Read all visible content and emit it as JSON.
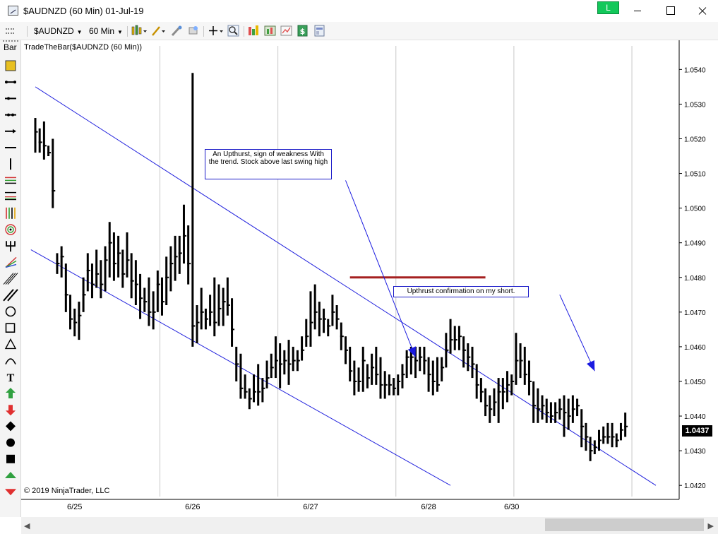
{
  "window": {
    "title": "$AUDNZD (60 Min)  01-Jul-19",
    "link_badge": "L",
    "link_badge_color": "#12c85a"
  },
  "toolbar": {
    "instrument": "$AUDNZD",
    "interval": "60 Min",
    "icons": [
      "bar-type-icon",
      "draw-line-icon",
      "pencil-icon",
      "zoom-icon",
      "crosshair-icon",
      "magnify-icon",
      "indicators-icon",
      "strategies-icon",
      "chart-properties-icon",
      "dollar-icon",
      "template-icon"
    ]
  },
  "left_tools": {
    "bar_label": "Bar",
    "tools": [
      "rectangle-tool-icon",
      "line-icon",
      "ray-icon",
      "extended-line-icon",
      "arrow-line-icon",
      "horizontal-line-icon",
      "vertical-line-icon",
      "fib-retracement-icon",
      "fib-extensions-icon",
      "fib-timezones-icon",
      "fib-circle-icon",
      "andrews-pitchfork-icon",
      "gann-fan-icon",
      "regression-channel-icon",
      "trend-channel-icon",
      "ellipse-icon",
      "rectangle-icon",
      "triangle-icon",
      "arc-icon",
      "text-icon",
      "arrow-up-icon",
      "arrow-down-icon",
      "diamond-icon",
      "dot-icon",
      "square-icon",
      "triangle-up-icon",
      "triangle-down-icon"
    ]
  },
  "chart": {
    "label": "TradeTheBar($AUDNZD (60 Min))",
    "copyright": "© 2019 NinjaTrader, LLC",
    "current_price": "1.0437",
    "annotation_1": "An Upthurst, sign of weakness With the trend. Stock above last swing high",
    "annotation_2": "Upthrust confirmation on my short."
  },
  "chart_data": {
    "type": "bar",
    "instrument": "$AUDNZD",
    "interval": "60 Min",
    "ylim": [
      1.0418,
      1.0547
    ],
    "price_ticks": [
      "1.0540",
      "1.0530",
      "1.0520",
      "1.0510",
      "1.0500",
      "1.0490",
      "1.0480",
      "1.0470",
      "1.0460",
      "1.0450",
      "1.0440",
      "1.0430",
      "1.0420"
    ],
    "date_ticks": [
      {
        "label": "6/25",
        "bar": 9
      },
      {
        "label": "6/26",
        "bar": 36
      },
      {
        "label": "6/27",
        "bar": 63
      },
      {
        "label": "6/28",
        "bar": 90
      },
      {
        "label": "6/30",
        "bar": 109
      }
    ],
    "session_breaks": [
      29,
      56,
      83,
      110,
      137
    ],
    "last_price": 1.0437,
    "hlc_bars": [
      [
        1.0526,
        1.0516,
        1.0522
      ],
      [
        1.0523,
        1.0516,
        1.0519
      ],
      [
        1.0525,
        1.0514,
        1.0518
      ],
      [
        1.0518,
        1.0515,
        1.0516
      ],
      [
        1.052,
        1.05,
        1.0505
      ],
      [
        1.0487,
        1.0481,
        1.0484
      ],
      [
        1.0489,
        1.048,
        1.0486
      ],
      [
        1.0484,
        1.047,
        1.0475
      ],
      [
        1.0475,
        1.0465,
        1.0468
      ],
      [
        1.0471,
        1.0463,
        1.0467
      ],
      [
        1.0473,
        1.0462,
        1.0469
      ],
      [
        1.048,
        1.047,
        1.0475
      ],
      [
        1.0487,
        1.0476,
        1.0482
      ],
      [
        1.0484,
        1.0474,
        1.0478
      ],
      [
        1.0488,
        1.0477,
        1.0481
      ],
      [
        1.0485,
        1.0474,
        1.0478
      ],
      [
        1.0489,
        1.0476,
        1.0485
      ],
      [
        1.0496,
        1.048,
        1.049
      ],
      [
        1.0493,
        1.0479,
        1.0484
      ],
      [
        1.0492,
        1.048,
        1.0487
      ],
      [
        1.0488,
        1.0477,
        1.0481
      ],
      [
        1.0493,
        1.048,
        1.0485
      ],
      [
        1.0487,
        1.0474,
        1.0479
      ],
      [
        1.0485,
        1.0472,
        1.0478
      ],
      [
        1.0481,
        1.0468,
        1.0474
      ],
      [
        1.0477,
        1.047,
        1.0473
      ],
      [
        1.048,
        1.0466,
        1.047
      ],
      [
        1.0476,
        1.0465,
        1.047
      ],
      [
        1.0482,
        1.047,
        1.0478
      ],
      [
        1.048,
        1.0469,
        1.0473
      ],
      [
        1.0486,
        1.0472,
        1.048
      ],
      [
        1.0489,
        1.0476,
        1.0484
      ],
      [
        1.0492,
        1.0479,
        1.0486
      ],
      [
        1.0492,
        1.0481,
        1.0487
      ],
      [
        1.0501,
        1.0484,
        1.0492
      ],
      [
        1.0495,
        1.0478,
        1.0484
      ],
      [
        1.0539,
        1.046,
        1.0466
      ],
      [
        1.0472,
        1.0461,
        1.0467
      ],
      [
        1.0477,
        1.0465,
        1.047
      ],
      [
        1.0471,
        1.0465,
        1.0468
      ],
      [
        1.0475,
        1.0466,
        1.047
      ],
      [
        1.048,
        1.0463,
        1.0467
      ],
      [
        1.0478,
        1.0466,
        1.0471
      ],
      [
        1.0477,
        1.0466,
        1.0473
      ],
      [
        1.048,
        1.0469,
        1.0472
      ],
      [
        1.0474,
        1.046,
        1.0465
      ],
      [
        1.046,
        1.045,
        1.0455
      ],
      [
        1.0458,
        1.0445,
        1.0448
      ],
      [
        1.0452,
        1.0445,
        1.0447
      ],
      [
        1.0448,
        1.0442,
        1.0445
      ],
      [
        1.0452,
        1.0444,
        1.0447
      ],
      [
        1.0455,
        1.0443,
        1.0447
      ],
      [
        1.0451,
        1.0444,
        1.0448
      ],
      [
        1.0456,
        1.0448,
        1.0451
      ],
      [
        1.0458,
        1.0451,
        1.0454
      ],
      [
        1.0463,
        1.0451,
        1.0456
      ],
      [
        1.0461,
        1.0448,
        1.0455
      ],
      [
        1.0459,
        1.0452,
        1.0456
      ],
      [
        1.0462,
        1.0449,
        1.0455
      ],
      [
        1.046,
        1.0453,
        1.0456
      ],
      [
        1.0459,
        1.0453,
        1.0456
      ],
      [
        1.0463,
        1.0456,
        1.0459
      ],
      [
        1.0468,
        1.046,
        1.0463
      ],
      [
        1.0476,
        1.046,
        1.0467
      ],
      [
        1.0478,
        1.0465,
        1.047
      ],
      [
        1.0473,
        1.0463,
        1.0468
      ],
      [
        1.0471,
        1.0464,
        1.0468
      ],
      [
        1.0468,
        1.0463,
        1.0466
      ],
      [
        1.0475,
        1.0466,
        1.047
      ],
      [
        1.0472,
        1.0465,
        1.0468
      ],
      [
        1.0467,
        1.0459,
        1.0463
      ],
      [
        1.0463,
        1.0455,
        1.0459
      ],
      [
        1.046,
        1.045,
        1.0453
      ],
      [
        1.0456,
        1.0446,
        1.045
      ],
      [
        1.0454,
        1.0447,
        1.045
      ],
      [
        1.046,
        1.0447,
        1.0456
      ],
      [
        1.0455,
        1.0448,
        1.0451
      ],
      [
        1.0458,
        1.0449,
        1.0454
      ],
      [
        1.046,
        1.0449,
        1.0452
      ],
      [
        1.0457,
        1.0445,
        1.0449
      ],
      [
        1.0453,
        1.0445,
        1.0449
      ],
      [
        1.0452,
        1.0446,
        1.0449
      ],
      [
        1.0451,
        1.0446,
        1.0448
      ],
      [
        1.0452,
        1.0446,
        1.045
      ],
      [
        1.0455,
        1.0448,
        1.0452
      ],
      [
        1.0459,
        1.0451,
        1.0457
      ],
      [
        1.046,
        1.0452,
        1.0457
      ],
      [
        1.046,
        1.0451,
        1.0456
      ],
      [
        1.046,
        1.0453,
        1.0457
      ],
      [
        1.046,
        1.0452,
        1.0456
      ],
      [
        1.0457,
        1.0447,
        1.0452
      ],
      [
        1.0456,
        1.0446,
        1.045
      ],
      [
        1.0457,
        1.0447,
        1.0449
      ],
      [
        1.0457,
        1.045,
        1.0454
      ],
      [
        1.0464,
        1.0454,
        1.0459
      ],
      [
        1.0468,
        1.0458,
        1.0462
      ],
      [
        1.0466,
        1.0459,
        1.0462
      ],
      [
        1.0466,
        1.0459,
        1.0463
      ],
      [
        1.0463,
        1.0454,
        1.0459
      ],
      [
        1.0461,
        1.0453,
        1.0457
      ],
      [
        1.046,
        1.0451,
        1.0455
      ],
      [
        1.0455,
        1.0445,
        1.0449
      ],
      [
        1.0451,
        1.0444,
        1.0447
      ],
      [
        1.0448,
        1.044,
        1.0443
      ],
      [
        1.0446,
        1.0438,
        1.0442
      ],
      [
        1.0448,
        1.044,
        1.0444
      ],
      [
        1.0451,
        1.0438,
        1.0447
      ],
      [
        1.0451,
        1.0442,
        1.0447
      ],
      [
        1.0453,
        1.0444,
        1.0449
      ],
      [
        1.0452,
        1.0446,
        1.045
      ],
      [
        1.0464,
        1.0449,
        1.0456
      ],
      [
        1.0461,
        1.0451,
        1.0456
      ],
      [
        1.046,
        1.0449,
        1.0452
      ],
      [
        1.0456,
        1.0446,
        1.045
      ],
      [
        1.045,
        1.0438,
        1.0443
      ],
      [
        1.0448,
        1.0438,
        1.0442
      ],
      [
        1.0446,
        1.0439,
        1.0443
      ],
      [
        1.0445,
        1.0438,
        1.0441
      ],
      [
        1.0444,
        1.0438,
        1.044
      ],
      [
        1.0444,
        1.0438,
        1.0441
      ],
      [
        1.0445,
        1.0439,
        1.0442
      ],
      [
        1.0446,
        1.0434,
        1.0441
      ],
      [
        1.0445,
        1.0436,
        1.044
      ],
      [
        1.0446,
        1.0438,
        1.0442
      ],
      [
        1.0445,
        1.044,
        1.0443
      ],
      [
        1.0442,
        1.0431,
        1.0437
      ],
      [
        1.0438,
        1.043,
        1.0434
      ],
      [
        1.0434,
        1.0427,
        1.043
      ],
      [
        1.0433,
        1.0429,
        1.0431
      ],
      [
        1.0436,
        1.043,
        1.0433
      ],
      [
        1.0437,
        1.0432,
        1.0434
      ],
      [
        1.0438,
        1.0432,
        1.0434
      ],
      [
        1.0438,
        1.0431,
        1.0434
      ],
      [
        1.0435,
        1.0431,
        1.0433
      ],
      [
        1.0438,
        1.0433,
        1.0436
      ],
      [
        1.0441,
        1.0434,
        1.0437
      ]
    ],
    "channel_upper": [
      [
        0,
        1.0535
      ],
      [
        142,
        1.042
      ]
    ],
    "channel_lower": [
      [
        -1,
        1.0488
      ],
      [
        95,
        1.042
      ]
    ],
    "resistance_line": {
      "price": 1.048,
      "from_bar": 72,
      "to_bar": 103,
      "color": "#a52020"
    },
    "arrows": [
      {
        "from_bar": 71,
        "from_price": 1.0508,
        "to_bar": 87,
        "to_price": 1.0457
      },
      {
        "from_bar": 120,
        "from_price": 1.0475,
        "to_bar": 128,
        "to_price": 1.0453
      }
    ],
    "colors": {
      "bars": "#000000",
      "channel": "#2222dd",
      "arrow": "#1a1ae0",
      "grid": "#c8c8c8"
    }
  }
}
